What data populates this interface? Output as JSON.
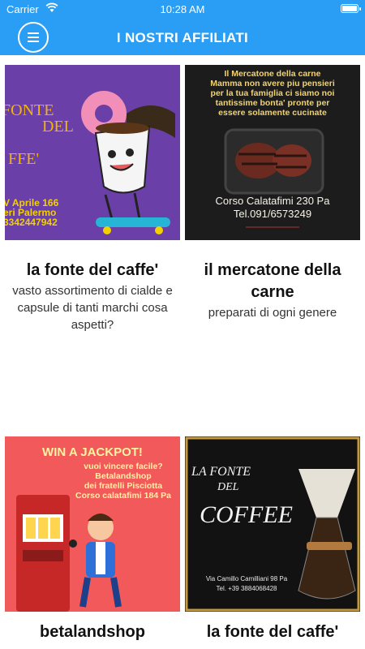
{
  "status": {
    "carrier": "Carrier",
    "time": "10:28 AM"
  },
  "header": {
    "title": "I NOSTRI AFFILIATI",
    "menu_icon": "hamburger-icon",
    "bg_color": "#2a9df4"
  },
  "cards": [
    {
      "name": "la fonte del caffe'",
      "desc": "vasto assortimento di cialde e capsule di tanti marchi cosa aspetti?",
      "image_text": {
        "line1": "FONTE",
        "line2": "DEL",
        "line3": "FFE'",
        "addr1": "V Aprile 166",
        "addr2": "eri Palermo",
        "phone": "3342447942"
      }
    },
    {
      "name": "il mercatone della carne",
      "desc": "preparati di ogni genere",
      "image_text": {
        "top1": "Il Mercatone della carne",
        "top2": "Mamma non avere piu pensieri",
        "top3": "per la tua famiglia ci siamo noi",
        "top4": "tantissime bonta' pronte per",
        "top5": "essere solamente cucinate",
        "addr": "Corso Calatafimi 230 Pa",
        "phone": "Tel.091/6573249"
      }
    },
    {
      "name": "betalandshop",
      "desc": "",
      "image_text": {
        "headline": "WIN A JACKPOT!",
        "l1": "vuoi vincere facile?",
        "l2": "Betalandshop",
        "l3": "dei fratelli Pisciotta",
        "l4": "Corso calatafimi 184 Pa"
      }
    },
    {
      "name": "la fonte del caffe'",
      "desc": "",
      "image_text": {
        "l1": "LA FONTE",
        "l2": "DEL",
        "l3": "COFFEE",
        "addr": "Via Camillo Camilliani 98 Pa",
        "phone": "Tel. +39 3884068428"
      }
    }
  ]
}
